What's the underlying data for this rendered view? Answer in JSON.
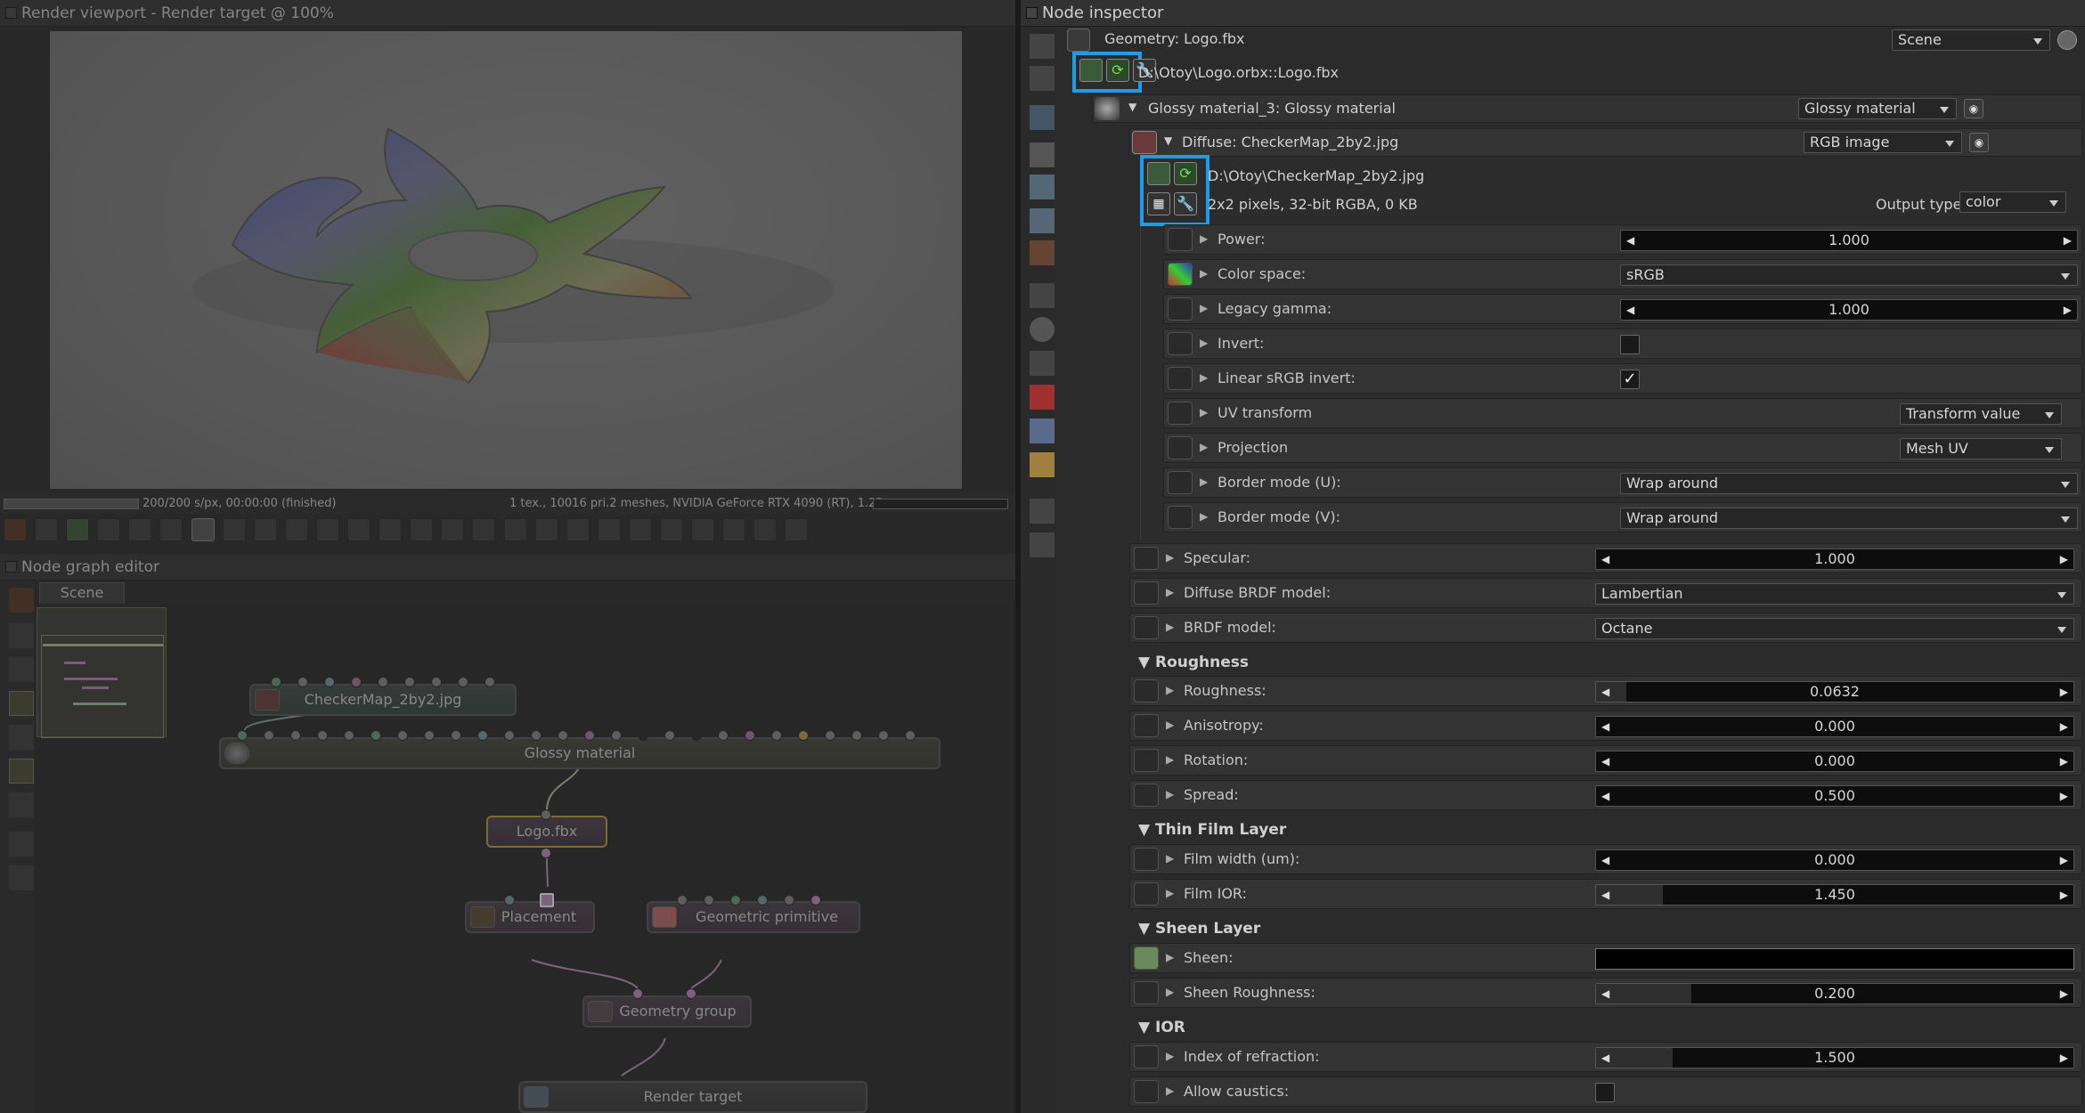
{
  "viewport": {
    "title": "Render viewport - Render target @ 100%",
    "status_left": "200/200 s/px, 00:00:00 (finished)",
    "status_right": "1 tex., 10016 pri.2 meshes, NVIDIA GeForce RTX 4090 (RT), 1.22..."
  },
  "node_graph": {
    "title": "Node graph editor",
    "tab": "Scene",
    "nodes": {
      "checker": "CheckerMap_2by2.jpg",
      "glossy": "Glossy material",
      "logo": "Logo.fbx",
      "placement": "Placement",
      "geometric": "Geometric primitive",
      "group": "Geometry group",
      "render": "Render target"
    }
  },
  "inspector": {
    "title": "Node inspector",
    "geometry_label": "Geometry: Logo.fbx",
    "scene_combo": "Scene",
    "geometry_path": "D:\\Otoy\\Logo.orbx::Logo.fbx",
    "material_label": "Glossy material_3: Glossy material",
    "material_combo": "Glossy material",
    "diffuse_label": "Diffuse: CheckerMap_2by2.jpg",
    "diffuse_combo": "RGB image",
    "image_path": "D:\\Otoy\\CheckerMap_2by2.jpg",
    "image_info": "2x2 pixels, 32-bit RGBA, 0 KB",
    "output_type_label": "Output type:",
    "output_type_value": "color",
    "image_params": {
      "power": {
        "label": "Power:",
        "value": "1.000"
      },
      "color_space": {
        "label": "Color space:",
        "value": "sRGB"
      },
      "legacy_gamma": {
        "label": "Legacy gamma:",
        "value": "1.000"
      },
      "invert": {
        "label": "Invert:"
      },
      "linear_srgb_invert": {
        "label": "Linear sRGB invert:",
        "check": "✓"
      },
      "uv_transform": {
        "label": "UV transform",
        "value": "Transform value"
      },
      "projection": {
        "label": "Projection",
        "value": "Mesh UV"
      },
      "border_u": {
        "label": "Border mode (U):",
        "value": "Wrap around"
      },
      "border_v": {
        "label": "Border mode (V):",
        "value": "Wrap around"
      }
    },
    "material_params": {
      "specular": {
        "label": "Specular:",
        "value": "1.000"
      },
      "diffuse_brdf": {
        "label": "Diffuse BRDF model:",
        "value": "Lambertian"
      },
      "brdf": {
        "label": "BRDF model:",
        "value": "Octane"
      }
    },
    "roughness": {
      "header": "Roughness",
      "roughness": {
        "label": "Roughness:",
        "value": "0.0632"
      },
      "anisotropy": {
        "label": "Anisotropy:",
        "value": "0.000"
      },
      "rotation": {
        "label": "Rotation:",
        "value": "0.000"
      },
      "spread": {
        "label": "Spread:",
        "value": "0.500"
      }
    },
    "thin_film": {
      "header": "Thin Film Layer",
      "film_width": {
        "label": "Film width (um):",
        "value": "0.000"
      },
      "film_ior": {
        "label": "Film IOR:",
        "value": "1.450"
      }
    },
    "sheen": {
      "header": "Sheen Layer",
      "sheen": {
        "label": "Sheen:"
      },
      "sheen_roughness": {
        "label": "Sheen Roughness:",
        "value": "0.200"
      }
    },
    "ior": {
      "header": "IOR",
      "ior": {
        "label": "Index of refraction:",
        "value": "1.500"
      },
      "caustics": {
        "label": "Allow caustics:"
      }
    }
  },
  "colors": {
    "highlight": "#1e9ce8",
    "panel_bg": "#2b2b2b"
  }
}
